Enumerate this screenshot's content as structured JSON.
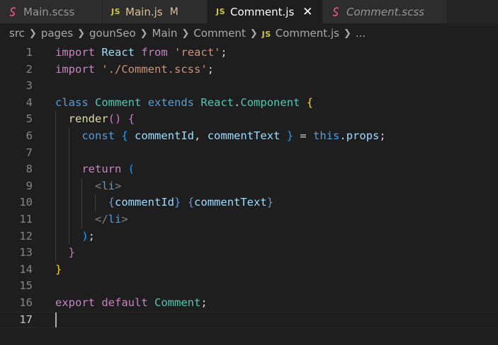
{
  "tabs": [
    {
      "label": "Main.scss",
      "icon": "sass-icon",
      "style": "normal"
    },
    {
      "label": "Main.js",
      "icon": "js-icon",
      "icon_text": "JS",
      "style": "modified",
      "badge": "M"
    },
    {
      "label": "Comment.js",
      "icon": "js-icon",
      "icon_text": "JS",
      "style": "active",
      "close": "✕"
    },
    {
      "label": "Comment.scss",
      "icon": "sass-icon",
      "style": "italic"
    }
  ],
  "breadcrumb": {
    "items": [
      "src",
      "pages",
      "gounSeo",
      "Main",
      "Comment"
    ],
    "file_icon_text": "JS",
    "file": "Comment.js",
    "more": "..."
  },
  "editor": {
    "active_line": 17,
    "lines": [
      {
        "n": "1",
        "tokens": [
          {
            "t": "import",
            "c": "kw"
          },
          {
            "t": " "
          },
          {
            "t": "React",
            "c": "vr"
          },
          {
            "t": " "
          },
          {
            "t": "from",
            "c": "kw"
          },
          {
            "t": " "
          },
          {
            "t": "'react'",
            "c": "st"
          },
          {
            "t": ";",
            "c": "pu"
          }
        ]
      },
      {
        "n": "2",
        "tokens": [
          {
            "t": "import",
            "c": "kw"
          },
          {
            "t": " "
          },
          {
            "t": "'./Comment.scss'",
            "c": "st"
          },
          {
            "t": ";",
            "c": "pu"
          }
        ]
      },
      {
        "n": "3",
        "tokens": []
      },
      {
        "n": "4",
        "tokens": [
          {
            "t": "class",
            "c": "dk"
          },
          {
            "t": " "
          },
          {
            "t": "Comment",
            "c": "cl"
          },
          {
            "t": " "
          },
          {
            "t": "extends",
            "c": "dk"
          },
          {
            "t": " "
          },
          {
            "t": "React",
            "c": "cl"
          },
          {
            "t": ".",
            "c": "pu"
          },
          {
            "t": "Component",
            "c": "cl"
          },
          {
            "t": " "
          },
          {
            "t": "{",
            "c": "b1"
          }
        ]
      },
      {
        "n": "5",
        "tokens": [
          {
            "t": "  "
          },
          {
            "t": "render",
            "c": "fn"
          },
          {
            "t": "(",
            "c": "b2"
          },
          {
            "t": ")",
            "c": "b2"
          },
          {
            "t": " "
          },
          {
            "t": "{",
            "c": "b2"
          }
        ]
      },
      {
        "n": "6",
        "tokens": [
          {
            "t": "    "
          },
          {
            "t": "const",
            "c": "dk"
          },
          {
            "t": " "
          },
          {
            "t": "{",
            "c": "b3"
          },
          {
            "t": " "
          },
          {
            "t": "commentId",
            "c": "vr"
          },
          {
            "t": ", ",
            "c": "pu"
          },
          {
            "t": "commentText",
            "c": "vr"
          },
          {
            "t": " "
          },
          {
            "t": "}",
            "c": "b3"
          },
          {
            "t": " = ",
            "c": "pu"
          },
          {
            "t": "this",
            "c": "dk"
          },
          {
            "t": ".",
            "c": "pu"
          },
          {
            "t": "props",
            "c": "vr"
          },
          {
            "t": ";",
            "c": "pu"
          }
        ]
      },
      {
        "n": "7",
        "tokens": []
      },
      {
        "n": "8",
        "tokens": [
          {
            "t": "    "
          },
          {
            "t": "return",
            "c": "kw"
          },
          {
            "t": " "
          },
          {
            "t": "(",
            "c": "b3"
          }
        ]
      },
      {
        "n": "9",
        "tokens": [
          {
            "t": "      "
          },
          {
            "t": "<",
            "c": "tg"
          },
          {
            "t": "li",
            "c": "dk"
          },
          {
            "t": ">",
            "c": "tg"
          }
        ]
      },
      {
        "n": "10",
        "tokens": [
          {
            "t": "        "
          },
          {
            "t": "{",
            "c": "dk"
          },
          {
            "t": "commentId",
            "c": "vr"
          },
          {
            "t": "}",
            "c": "dk"
          },
          {
            "t": " "
          },
          {
            "t": "{",
            "c": "dk"
          },
          {
            "t": "commentText",
            "c": "vr"
          },
          {
            "t": "}",
            "c": "dk"
          }
        ]
      },
      {
        "n": "11",
        "tokens": [
          {
            "t": "      "
          },
          {
            "t": "</",
            "c": "tg"
          },
          {
            "t": "li",
            "c": "dk"
          },
          {
            "t": ">",
            "c": "tg"
          }
        ]
      },
      {
        "n": "12",
        "tokens": [
          {
            "t": "    "
          },
          {
            "t": ")",
            "c": "b3"
          },
          {
            "t": ";",
            "c": "pu"
          }
        ]
      },
      {
        "n": "13",
        "tokens": [
          {
            "t": "  "
          },
          {
            "t": "}",
            "c": "b2"
          }
        ]
      },
      {
        "n": "14",
        "tokens": [
          {
            "t": "}",
            "c": "b1"
          }
        ]
      },
      {
        "n": "15",
        "tokens": []
      },
      {
        "n": "16",
        "tokens": [
          {
            "t": "export",
            "c": "kw"
          },
          {
            "t": " "
          },
          {
            "t": "default",
            "c": "kw"
          },
          {
            "t": " "
          },
          {
            "t": "Comment",
            "c": "cl"
          },
          {
            "t": ";",
            "c": "pu"
          }
        ]
      },
      {
        "n": "17",
        "tokens": []
      }
    ]
  },
  "colors": {
    "background": "#1e1e1e",
    "tab_inactive": "#2d2d2d",
    "sass_pink": "#f55385",
    "js_yellow": "#cbcb41",
    "modified": "#e2c08d"
  }
}
